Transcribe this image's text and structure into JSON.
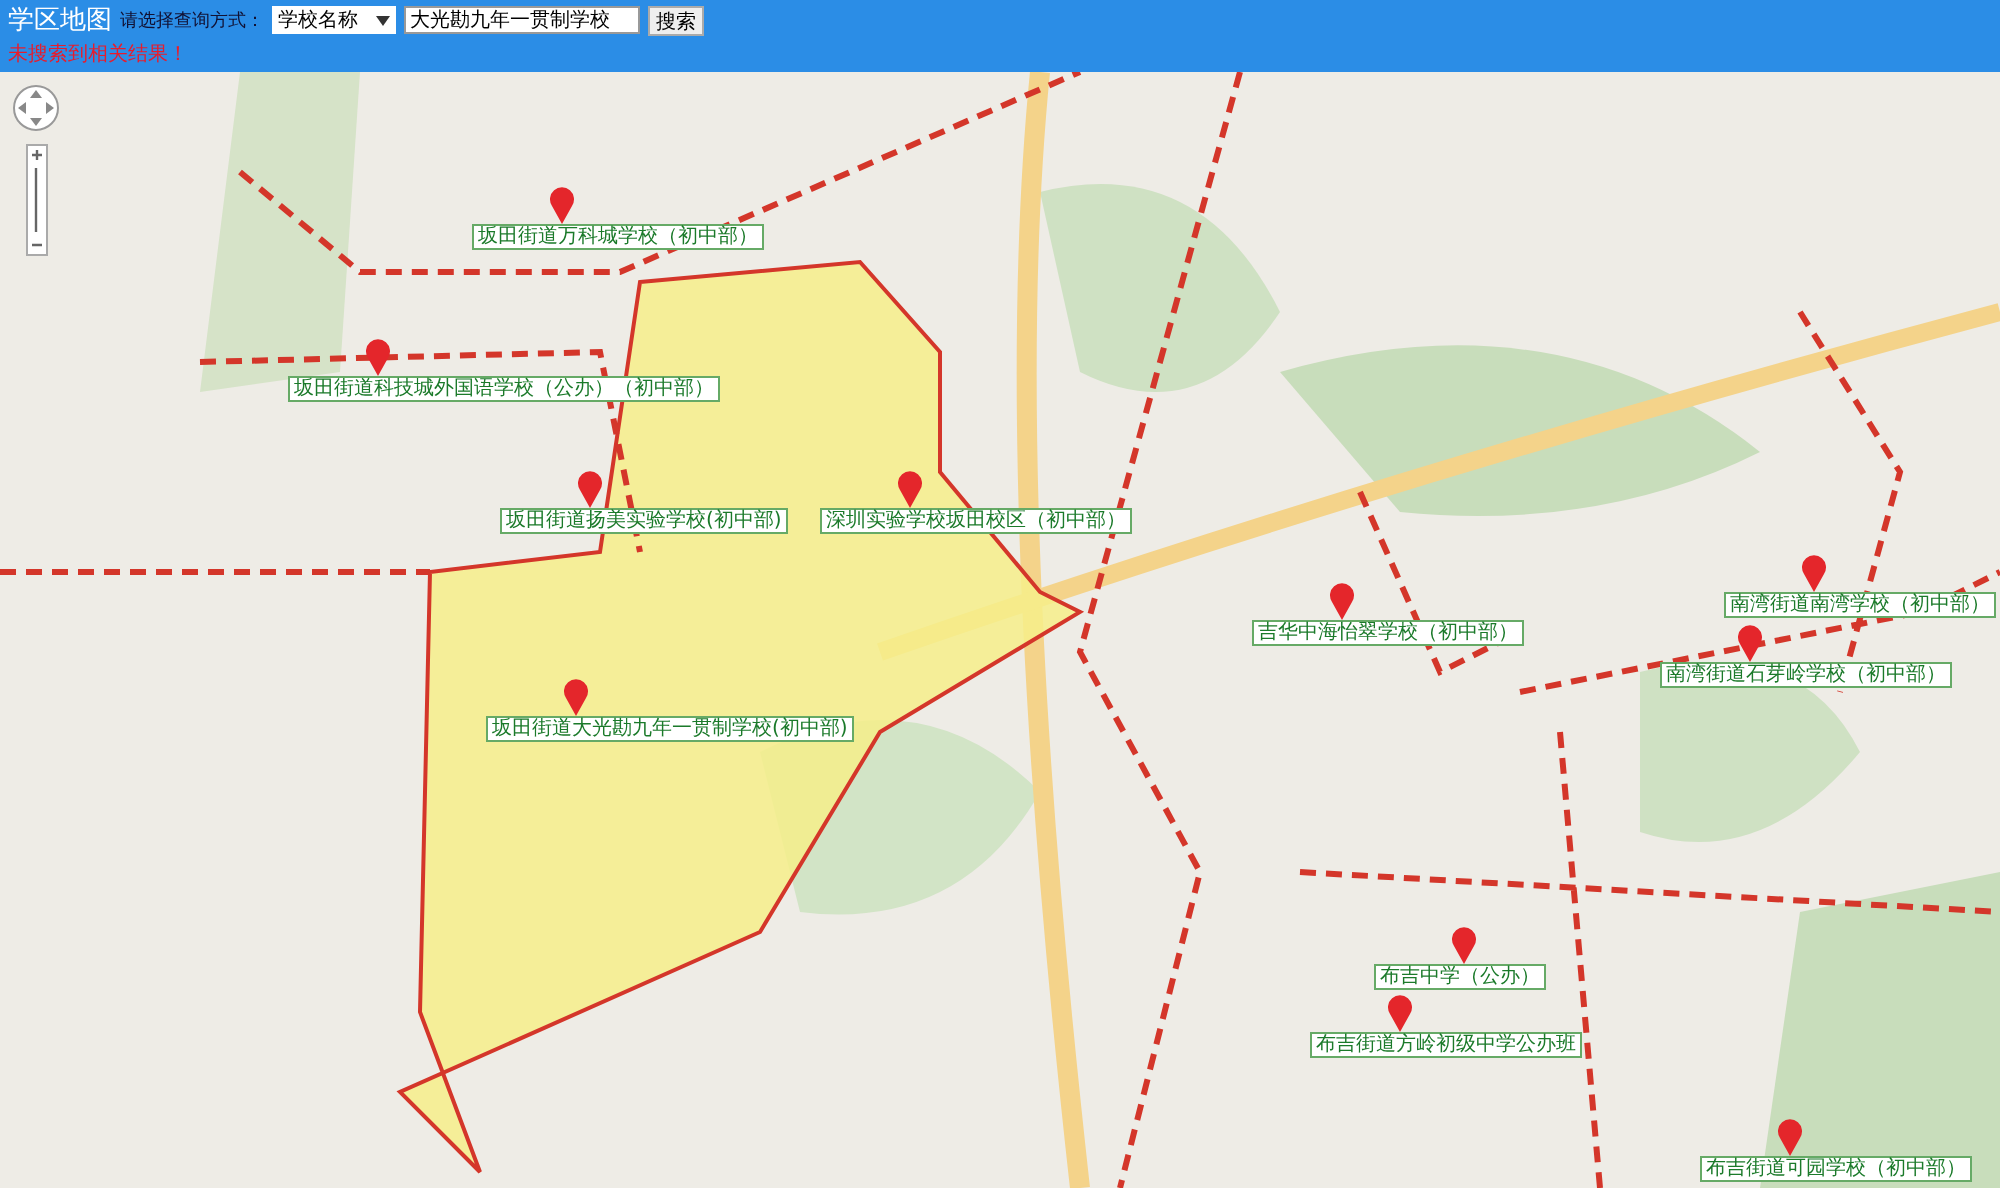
{
  "header": {
    "title": "学区地图",
    "query_label": "请选择查询方式：",
    "query_type": "学校名称",
    "search_value": "大光勘九年一贯制学校",
    "search_button": "搜索",
    "message": "未搜索到相关结果！"
  },
  "map": {
    "kind": "picture",
    "schools": [
      {
        "name": "坂田街道万科城学校（初中部）"
      },
      {
        "name": "坂田街道科技城外国语学校（公办）（初中部）"
      },
      {
        "name": "坂田街道扬美实验学校(初中部)"
      },
      {
        "name": "深圳实验学校坂田校区（初中部）"
      },
      {
        "name": "坂田街道大光勘九年一贯制学校(初中部)"
      },
      {
        "name": "吉华中海怡翠学校（初中部）"
      },
      {
        "name": "南湾街道南湾学校（初中部）"
      },
      {
        "name": "南湾街道石芽岭学校（初中部）"
      },
      {
        "name": "布吉中学（公办）"
      },
      {
        "name": "布吉街道方岭初级中学公办班"
      },
      {
        "name": "布吉街道可园学校（初中部）"
      }
    ]
  }
}
